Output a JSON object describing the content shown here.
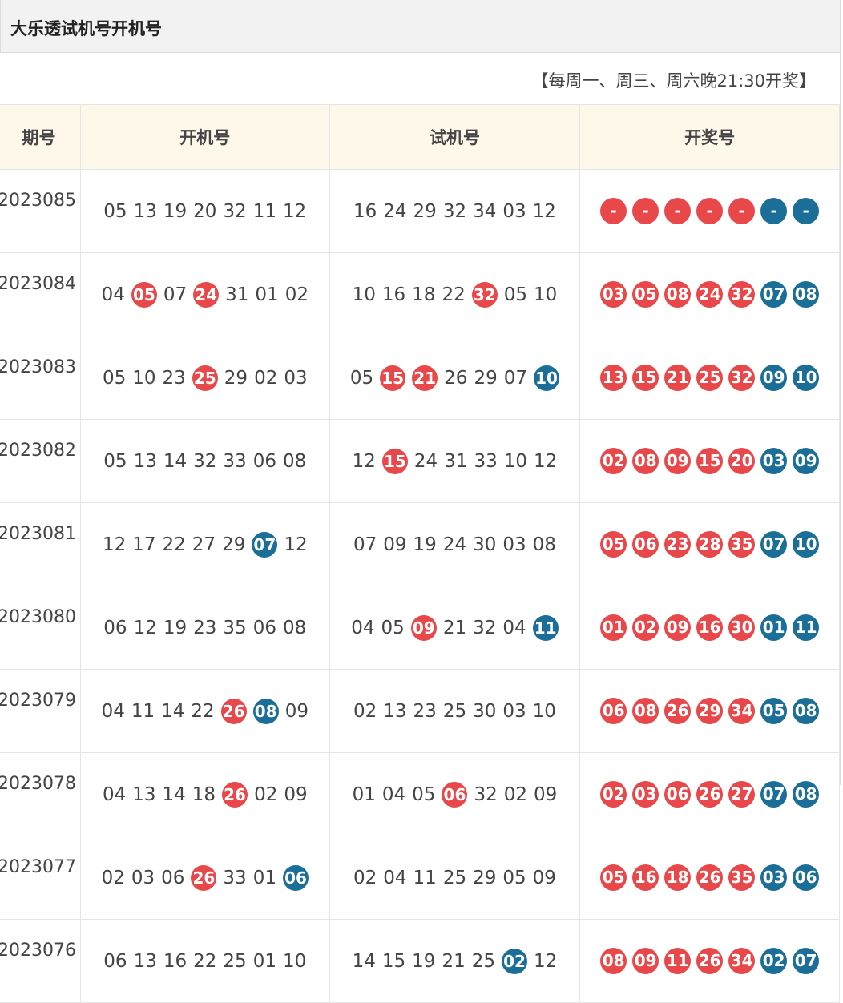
{
  "page": {
    "title": "大乐透试机号开机号",
    "notice": "【每周一、周三、周六晚21:30开奖】"
  },
  "colors": {
    "red": "#e8484a",
    "blue": "#1a6e98",
    "header_bg": "#fdf8ea"
  },
  "table": {
    "headers": [
      "期号",
      "开机号",
      "试机号",
      "开奖号"
    ],
    "rows": [
      {
        "issue": "2023085",
        "open": [
          [
            "05",
            ""
          ],
          [
            "13",
            ""
          ],
          [
            "19",
            ""
          ],
          [
            "20",
            ""
          ],
          [
            "32",
            ""
          ],
          [
            "11",
            ""
          ],
          [
            "12",
            ""
          ]
        ],
        "test": [
          [
            "16",
            ""
          ],
          [
            "24",
            ""
          ],
          [
            "29",
            ""
          ],
          [
            "32",
            ""
          ],
          [
            "34",
            ""
          ],
          [
            "03",
            ""
          ],
          [
            "12",
            ""
          ]
        ],
        "draw": [
          [
            "-",
            "red"
          ],
          [
            "-",
            "red"
          ],
          [
            "-",
            "red"
          ],
          [
            "-",
            "red"
          ],
          [
            "-",
            "red"
          ],
          [
            "-",
            "blue"
          ],
          [
            "-",
            "blue"
          ]
        ]
      },
      {
        "issue": "2023084",
        "open": [
          [
            "04",
            ""
          ],
          [
            "05",
            "red"
          ],
          [
            "07",
            ""
          ],
          [
            "24",
            "red"
          ],
          [
            "31",
            ""
          ],
          [
            "01",
            ""
          ],
          [
            "02",
            ""
          ]
        ],
        "test": [
          [
            "10",
            ""
          ],
          [
            "16",
            ""
          ],
          [
            "18",
            ""
          ],
          [
            "22",
            ""
          ],
          [
            "32",
            "red"
          ],
          [
            "05",
            ""
          ],
          [
            "10",
            ""
          ]
        ],
        "draw": [
          [
            "03",
            "red"
          ],
          [
            "05",
            "red"
          ],
          [
            "08",
            "red"
          ],
          [
            "24",
            "red"
          ],
          [
            "32",
            "red"
          ],
          [
            "07",
            "blue"
          ],
          [
            "08",
            "blue"
          ]
        ]
      },
      {
        "issue": "2023083",
        "open": [
          [
            "05",
            ""
          ],
          [
            "10",
            ""
          ],
          [
            "23",
            ""
          ],
          [
            "25",
            "red"
          ],
          [
            "29",
            ""
          ],
          [
            "02",
            ""
          ],
          [
            "03",
            ""
          ]
        ],
        "test": [
          [
            "05",
            ""
          ],
          [
            "15",
            "red"
          ],
          [
            "21",
            "red"
          ],
          [
            "26",
            ""
          ],
          [
            "29",
            ""
          ],
          [
            "07",
            ""
          ],
          [
            "10",
            "blue"
          ]
        ],
        "draw": [
          [
            "13",
            "red"
          ],
          [
            "15",
            "red"
          ],
          [
            "21",
            "red"
          ],
          [
            "25",
            "red"
          ],
          [
            "32",
            "red"
          ],
          [
            "09",
            "blue"
          ],
          [
            "10",
            "blue"
          ]
        ]
      },
      {
        "issue": "2023082",
        "open": [
          [
            "05",
            ""
          ],
          [
            "13",
            ""
          ],
          [
            "14",
            ""
          ],
          [
            "32",
            ""
          ],
          [
            "33",
            ""
          ],
          [
            "06",
            ""
          ],
          [
            "08",
            ""
          ]
        ],
        "test": [
          [
            "12",
            ""
          ],
          [
            "15",
            "red"
          ],
          [
            "24",
            ""
          ],
          [
            "31",
            ""
          ],
          [
            "33",
            ""
          ],
          [
            "10",
            ""
          ],
          [
            "12",
            ""
          ]
        ],
        "draw": [
          [
            "02",
            "red"
          ],
          [
            "08",
            "red"
          ],
          [
            "09",
            "red"
          ],
          [
            "15",
            "red"
          ],
          [
            "20",
            "red"
          ],
          [
            "03",
            "blue"
          ],
          [
            "09",
            "blue"
          ]
        ]
      },
      {
        "issue": "2023081",
        "open": [
          [
            "12",
            ""
          ],
          [
            "17",
            ""
          ],
          [
            "22",
            ""
          ],
          [
            "27",
            ""
          ],
          [
            "29",
            ""
          ],
          [
            "07",
            "blue"
          ],
          [
            "12",
            ""
          ]
        ],
        "test": [
          [
            "07",
            ""
          ],
          [
            "09",
            ""
          ],
          [
            "19",
            ""
          ],
          [
            "24",
            ""
          ],
          [
            "30",
            ""
          ],
          [
            "03",
            ""
          ],
          [
            "08",
            ""
          ]
        ],
        "draw": [
          [
            "05",
            "red"
          ],
          [
            "06",
            "red"
          ],
          [
            "23",
            "red"
          ],
          [
            "28",
            "red"
          ],
          [
            "35",
            "red"
          ],
          [
            "07",
            "blue"
          ],
          [
            "10",
            "blue"
          ]
        ]
      },
      {
        "issue": "2023080",
        "open": [
          [
            "06",
            ""
          ],
          [
            "12",
            ""
          ],
          [
            "19",
            ""
          ],
          [
            "23",
            ""
          ],
          [
            "35",
            ""
          ],
          [
            "06",
            ""
          ],
          [
            "08",
            ""
          ]
        ],
        "test": [
          [
            "04",
            ""
          ],
          [
            "05",
            ""
          ],
          [
            "09",
            "red"
          ],
          [
            "21",
            ""
          ],
          [
            "32",
            ""
          ],
          [
            "04",
            ""
          ],
          [
            "11",
            "blue"
          ]
        ],
        "draw": [
          [
            "01",
            "red"
          ],
          [
            "02",
            "red"
          ],
          [
            "09",
            "red"
          ],
          [
            "16",
            "red"
          ],
          [
            "30",
            "red"
          ],
          [
            "01",
            "blue"
          ],
          [
            "11",
            "blue"
          ]
        ]
      },
      {
        "issue": "2023079",
        "open": [
          [
            "04",
            ""
          ],
          [
            "11",
            ""
          ],
          [
            "14",
            ""
          ],
          [
            "22",
            ""
          ],
          [
            "26",
            "red"
          ],
          [
            "08",
            "blue"
          ],
          [
            "09",
            ""
          ]
        ],
        "test": [
          [
            "02",
            ""
          ],
          [
            "13",
            ""
          ],
          [
            "23",
            ""
          ],
          [
            "25",
            ""
          ],
          [
            "30",
            ""
          ],
          [
            "03",
            ""
          ],
          [
            "10",
            ""
          ]
        ],
        "draw": [
          [
            "06",
            "red"
          ],
          [
            "08",
            "red"
          ],
          [
            "26",
            "red"
          ],
          [
            "29",
            "red"
          ],
          [
            "34",
            "red"
          ],
          [
            "05",
            "blue"
          ],
          [
            "08",
            "blue"
          ]
        ]
      },
      {
        "issue": "2023078",
        "open": [
          [
            "04",
            ""
          ],
          [
            "13",
            ""
          ],
          [
            "14",
            ""
          ],
          [
            "18",
            ""
          ],
          [
            "26",
            "red"
          ],
          [
            "02",
            ""
          ],
          [
            "09",
            ""
          ]
        ],
        "test": [
          [
            "01",
            ""
          ],
          [
            "04",
            ""
          ],
          [
            "05",
            ""
          ],
          [
            "06",
            "red"
          ],
          [
            "32",
            ""
          ],
          [
            "02",
            ""
          ],
          [
            "09",
            ""
          ]
        ],
        "draw": [
          [
            "02",
            "red"
          ],
          [
            "03",
            "red"
          ],
          [
            "06",
            "red"
          ],
          [
            "26",
            "red"
          ],
          [
            "27",
            "red"
          ],
          [
            "07",
            "blue"
          ],
          [
            "08",
            "blue"
          ]
        ]
      },
      {
        "issue": "2023077",
        "open": [
          [
            "02",
            ""
          ],
          [
            "03",
            ""
          ],
          [
            "06",
            ""
          ],
          [
            "26",
            "red"
          ],
          [
            "33",
            ""
          ],
          [
            "01",
            ""
          ],
          [
            "06",
            "blue"
          ]
        ],
        "test": [
          [
            "02",
            ""
          ],
          [
            "04",
            ""
          ],
          [
            "11",
            ""
          ],
          [
            "25",
            ""
          ],
          [
            "29",
            ""
          ],
          [
            "05",
            ""
          ],
          [
            "09",
            ""
          ]
        ],
        "draw": [
          [
            "05",
            "red"
          ],
          [
            "16",
            "red"
          ],
          [
            "18",
            "red"
          ],
          [
            "26",
            "red"
          ],
          [
            "35",
            "red"
          ],
          [
            "03",
            "blue"
          ],
          [
            "06",
            "blue"
          ]
        ]
      },
      {
        "issue": "2023076",
        "open": [
          [
            "06",
            ""
          ],
          [
            "13",
            ""
          ],
          [
            "16",
            ""
          ],
          [
            "22",
            ""
          ],
          [
            "25",
            ""
          ],
          [
            "01",
            ""
          ],
          [
            "10",
            ""
          ]
        ],
        "test": [
          [
            "14",
            ""
          ],
          [
            "15",
            ""
          ],
          [
            "19",
            ""
          ],
          [
            "21",
            ""
          ],
          [
            "25",
            ""
          ],
          [
            "02",
            "blue"
          ],
          [
            "12",
            ""
          ]
        ],
        "draw": [
          [
            "08",
            "red"
          ],
          [
            "09",
            "red"
          ],
          [
            "11",
            "red"
          ],
          [
            "26",
            "red"
          ],
          [
            "34",
            "red"
          ],
          [
            "02",
            "blue"
          ],
          [
            "07",
            "blue"
          ]
        ]
      }
    ]
  }
}
